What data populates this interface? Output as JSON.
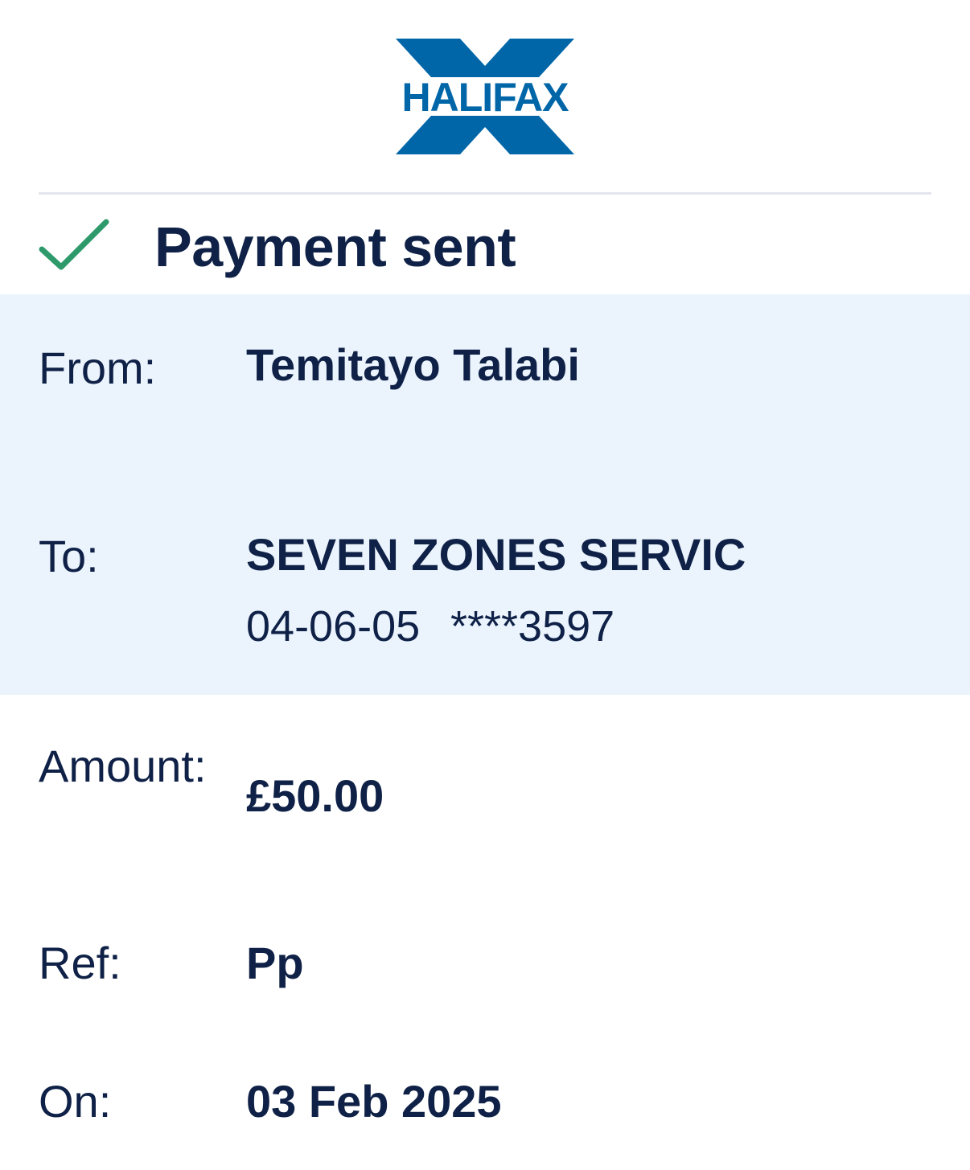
{
  "brand": {
    "name": "HALIFAX",
    "primary_color": "#0066a8",
    "text_color": "#0f2147",
    "success_color": "#2e9a6b",
    "panel_color": "#ebf4fd"
  },
  "status": {
    "icon": "check-icon",
    "title": "Payment sent"
  },
  "details": {
    "from_label": "From:",
    "from_value": "Temitayo Talabi",
    "to_label": "To:",
    "to_name": "SEVEN ZONES SERVIC",
    "to_sort_code": "04-06-05",
    "to_account": "****3597",
    "amount_label": "Amount:",
    "amount_value": "£50.00",
    "ref_label": "Ref:",
    "ref_value": "Pp",
    "on_label": "On:",
    "on_value": "03 Feb 2025"
  }
}
